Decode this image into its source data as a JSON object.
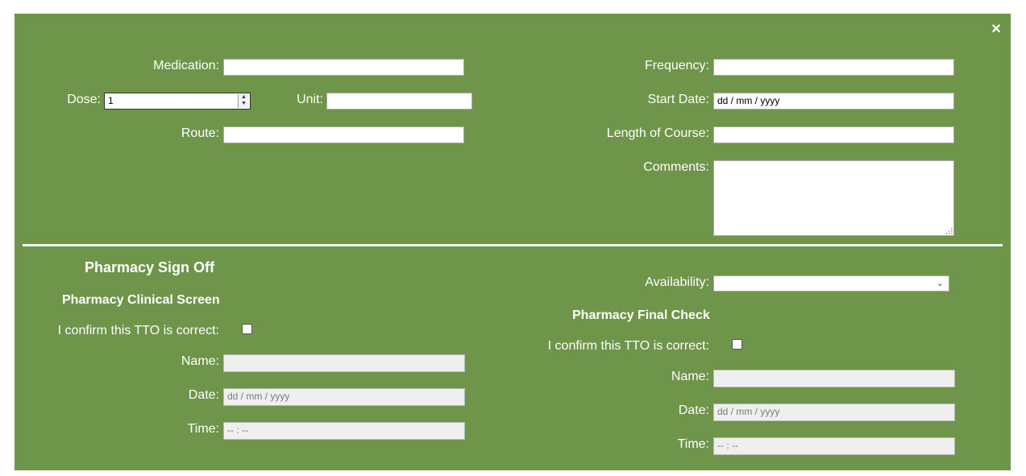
{
  "close_icon": "×",
  "medication": {
    "label": "Medication:",
    "value": ""
  },
  "dose": {
    "label": "Dose:",
    "value": "1"
  },
  "unit": {
    "label": "Unit:",
    "value": ""
  },
  "route": {
    "label": "Route:",
    "value": ""
  },
  "frequency": {
    "label": "Frequency:",
    "value": ""
  },
  "start_date": {
    "label": "Start Date:",
    "placeholder": "dd / mm / yyyy"
  },
  "length_of_course": {
    "label": "Length of Course:",
    "value": ""
  },
  "comments": {
    "label": "Comments:",
    "value": ""
  },
  "pharmacy": {
    "title": "Pharmacy Sign Off",
    "clinical_screen": {
      "title": "Pharmacy Clinical Screen",
      "confirm_label": "I confirm this TTO is correct:",
      "confirm_checked": false,
      "name_label": "Name:",
      "date_label": "Date:",
      "date_placeholder": "dd / mm / yyyy",
      "time_label": "Time:",
      "time_placeholder": "-- : --"
    },
    "availability": {
      "label": "Availability:",
      "value": ""
    },
    "final_check": {
      "title": "Pharmacy Final Check",
      "confirm_label": "I confirm this TTO is correct:",
      "confirm_checked": false,
      "name_label": "Name:",
      "date_label": "Date:",
      "date_placeholder": "dd / mm / yyyy",
      "time_label": "Time:",
      "time_placeholder": "-- : --"
    }
  },
  "colors": {
    "panel_background": "#6f954b",
    "text": "#ffffff",
    "input_background": "#ffffff",
    "disabled_input_background": "#efefef"
  }
}
